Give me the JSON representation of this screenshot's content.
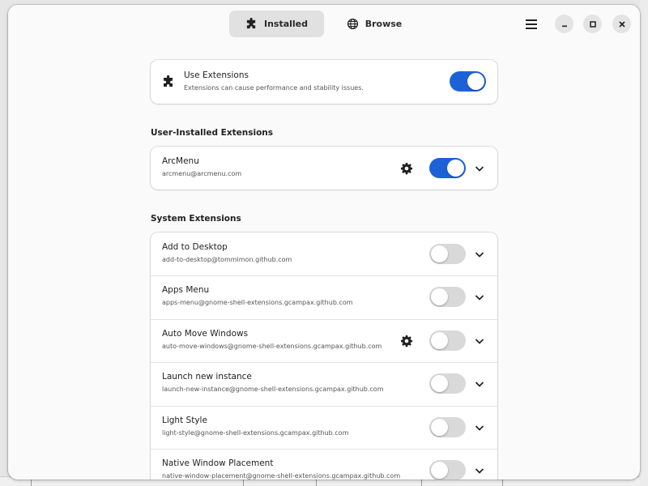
{
  "header": {
    "tabs": [
      {
        "label": "Installed",
        "icon": "puzzle-icon",
        "active": true
      },
      {
        "label": "Browse",
        "icon": "globe-icon",
        "active": false
      }
    ]
  },
  "use_extensions": {
    "title": "Use Extensions",
    "subtitle": "Extensions can cause performance and stability issues.",
    "enabled": true
  },
  "sections": {
    "user_title": "User-Installed Extensions",
    "system_title": "System Extensions"
  },
  "user_extensions": [
    {
      "name": "ArcMenu",
      "uuid": "arcmenu@arcmenu.com",
      "has_settings": true,
      "enabled": true
    }
  ],
  "system_extensions": [
    {
      "name": "Add to Desktop",
      "uuid": "add-to-desktop@tommimon.github.com",
      "has_settings": false,
      "enabled": false
    },
    {
      "name": "Apps Menu",
      "uuid": "apps-menu@gnome-shell-extensions.gcampax.github.com",
      "has_settings": false,
      "enabled": false
    },
    {
      "name": "Auto Move Windows",
      "uuid": "auto-move-windows@gnome-shell-extensions.gcampax.github.com",
      "has_settings": true,
      "enabled": false
    },
    {
      "name": "Launch new instance",
      "uuid": "launch-new-instance@gnome-shell-extensions.gcampax.github.com",
      "has_settings": false,
      "enabled": false
    },
    {
      "name": "Light Style",
      "uuid": "light-style@gnome-shell-extensions.gcampax.github.com",
      "has_settings": false,
      "enabled": false
    },
    {
      "name": "Native Window Placement",
      "uuid": "native-window-placement@gnome-shell-extensions.gcampax.github.com",
      "has_settings": false,
      "enabled": false
    }
  ],
  "colors": {
    "accent": "#1c62d6",
    "toggle_off": "#d9d9d9",
    "window_bg": "#fafafa"
  }
}
